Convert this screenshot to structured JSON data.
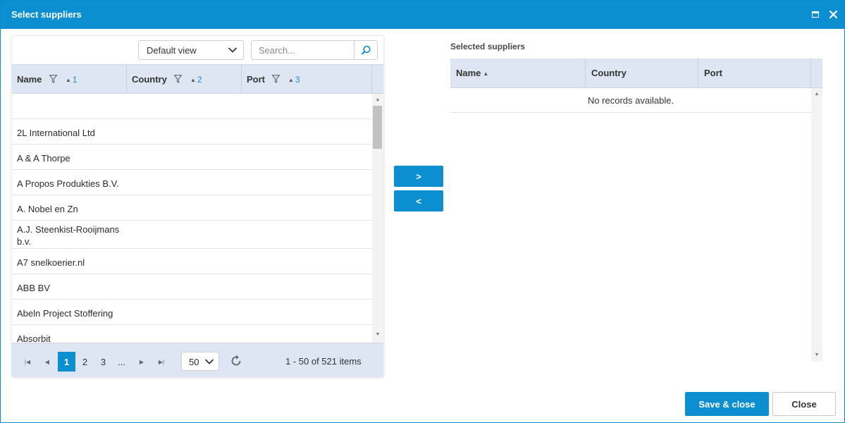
{
  "window": {
    "title": "Select suppliers",
    "maximize_icon": "maximize-icon",
    "close_icon": "close-icon",
    "accent_color": "#0b8fd0"
  },
  "toolbar": {
    "view_select_value": "Default view",
    "search_placeholder": "Search...",
    "search_value": ""
  },
  "left_grid": {
    "columns": [
      {
        "label": "Name",
        "sort_order": "1",
        "sort_direction": "asc"
      },
      {
        "label": "Country",
        "sort_order": "2",
        "sort_direction": "asc"
      },
      {
        "label": "Port",
        "sort_order": "3",
        "sort_direction": "asc"
      }
    ],
    "rows": [
      {
        "name": ""
      },
      {
        "name": "2L International Ltd"
      },
      {
        "name": "A & A Thorpe"
      },
      {
        "name": "A Propos Produkties B.V."
      },
      {
        "name": "A. Nobel en Zn"
      },
      {
        "name": "A.J. Steenkist-Rooijmans b.v."
      },
      {
        "name": "A7 snelkoerier.nl"
      },
      {
        "name": "ABB BV"
      },
      {
        "name": "Abeln Project Stoffering"
      },
      {
        "name": "Absorbit"
      }
    ]
  },
  "pager": {
    "first_icon": "first-page-icon",
    "prev_icon": "prev-page-icon",
    "next_icon": "next-page-icon",
    "last_icon": "last-page-icon",
    "pages": [
      "1",
      "2",
      "3",
      "..."
    ],
    "current_page": "1",
    "page_size": "50",
    "refresh_icon": "refresh-icon",
    "info": "1 - 50 of 521 items"
  },
  "transfer": {
    "add_label": ">",
    "remove_label": "<"
  },
  "right_grid": {
    "title": "Selected suppliers",
    "columns": [
      {
        "label": "Name",
        "sort_direction": "asc"
      },
      {
        "label": "Country"
      },
      {
        "label": "Port"
      }
    ],
    "empty_message": "No records available."
  },
  "footer": {
    "save_label": "Save & close",
    "close_label": "Close"
  }
}
